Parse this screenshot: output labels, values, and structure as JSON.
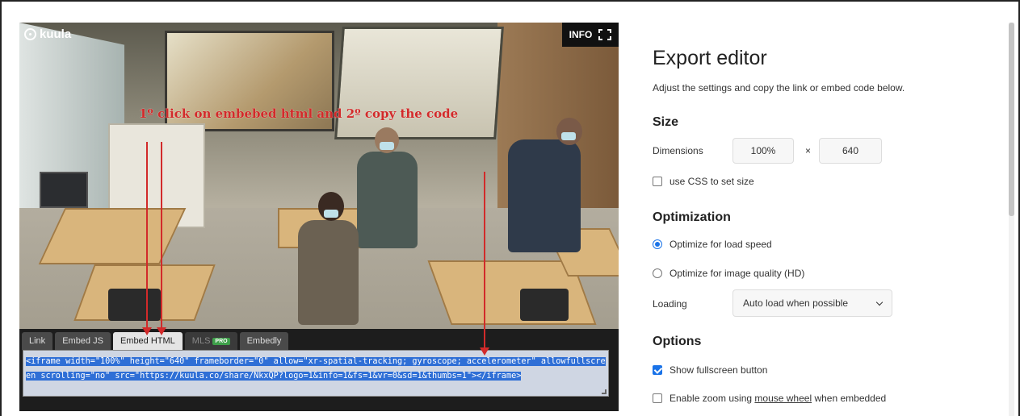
{
  "viewer": {
    "logo_text": "kuula",
    "info_label": "INFO",
    "annotation": "1º click on embebed html and 2º copy the code",
    "tabs": [
      {
        "label": "Link",
        "state": "normal"
      },
      {
        "label": "Embed JS",
        "state": "normal"
      },
      {
        "label": "Embed HTML",
        "state": "active"
      },
      {
        "label": "MLS",
        "state": "disabled",
        "badge": "PRO"
      },
      {
        "label": "Embedly",
        "state": "normal"
      }
    ],
    "embed_code": "<iframe width=\"100%\" height=\"640\" frameborder=\"0\" allow=\"xr-spatial-tracking; gyroscope; accelerometer\" allowfullscreen scrolling=\"no\" src=\"https://kuula.co/share/NkxQP?logo=1&info=1&fs=1&vr=0&sd=1&thumbs=1\"></iframe>",
    "colors": {
      "annotation": "#d22a2a",
      "selection": "#2f6fd6",
      "pro_badge": "#3ea04a"
    }
  },
  "editor": {
    "title": "Export editor",
    "subtitle": "Adjust the settings and copy the link or embed code below.",
    "size": {
      "heading": "Size",
      "dimensions_label": "Dimensions",
      "width_value": "100%",
      "times_symbol": "×",
      "height_value": "640",
      "css_checkbox": {
        "label": "use CSS to set size",
        "checked": false
      }
    },
    "optimization": {
      "heading": "Optimization",
      "options": [
        {
          "label": "Optimize for load speed",
          "selected": true
        },
        {
          "label": "Optimize for image quality (HD)",
          "selected": false
        }
      ],
      "loading_label": "Loading",
      "loading_value": "Auto load when possible"
    },
    "options": {
      "heading": "Options",
      "fullscreen": {
        "label": "Show fullscreen button",
        "checked": true
      },
      "zoom": {
        "label_pre": "Enable zoom using ",
        "label_link": "mouse wheel",
        "label_post": " when embedded",
        "checked": false
      }
    },
    "accent_color": "#1a73e8"
  }
}
